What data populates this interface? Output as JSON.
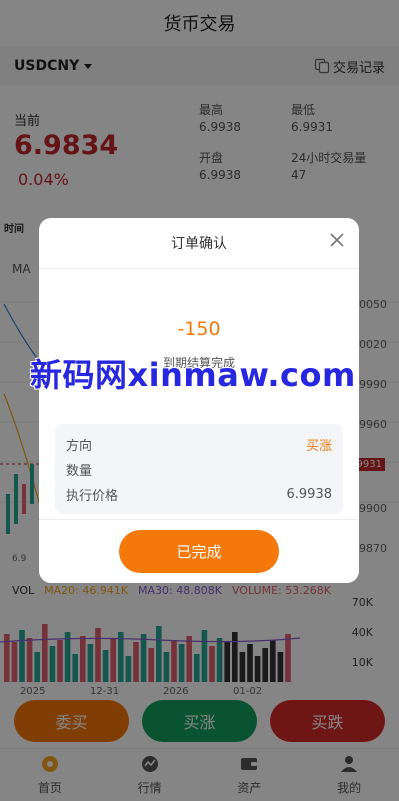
{
  "header": {
    "title": "货币交易"
  },
  "subbar": {
    "pair": "USDCNY",
    "records_label": "交易记录",
    "records_icon": "copy-icon"
  },
  "price": {
    "current_label": "当前",
    "current_value": "6.9834",
    "change": "0.04%",
    "high_label": "最高",
    "high_value": "6.9938",
    "low_label": "最低",
    "low_value": "6.9931",
    "open_label": "开盘",
    "open_value": "6.9938",
    "volume24_label": "24小时交易量",
    "volume24_value": "47"
  },
  "chart": {
    "timeframe_label": "时间",
    "ma_label": "MA",
    "y_axis": [
      "0050",
      "0020",
      "9990",
      "9960",
      "9931",
      "9900",
      "9870"
    ],
    "current_axis_label": "9931",
    "candle_low_label": "6.9",
    "volume": {
      "vol_label": "VOL",
      "ma20": "MA20: 46.941K",
      "ma30": "MA30: 48.808K",
      "volume": "VOLUME: 53.268K",
      "axis": [
        "70K",
        "40K",
        "10K"
      ]
    },
    "dates": [
      "2025",
      "12-31",
      "2026",
      "01-02"
    ],
    "colors": {
      "up": "#e06070",
      "down": "#2aa898",
      "up_dim": "#333333",
      "ma20": "#f5a623",
      "ma30": "#8a5cd1"
    }
  },
  "buttons": {
    "entrust": "委买",
    "buy_up": "买涨",
    "buy_down": "买跌",
    "colors": {
      "entrust": "#f5780a",
      "buy_up": "#13a05c",
      "buy_down": "#d42b2b"
    }
  },
  "tabs": [
    {
      "label": "首页",
      "icon": "home-icon"
    },
    {
      "label": "行情",
      "icon": "market-icon"
    },
    {
      "label": "资产",
      "icon": "wallet-icon"
    },
    {
      "label": "我的",
      "icon": "user-icon"
    }
  ],
  "modal": {
    "title": "订单确认",
    "pnl": "-150",
    "settle_text": "到期结算完成",
    "rows": [
      {
        "key": "方向",
        "value": "买涨"
      },
      {
        "key": "数量",
        "value": ""
      },
      {
        "key": "执行价格",
        "value": "6.9938"
      }
    ],
    "done_label": "已完成"
  },
  "watermark": {
    "text": "新码网xinmaw.com"
  }
}
